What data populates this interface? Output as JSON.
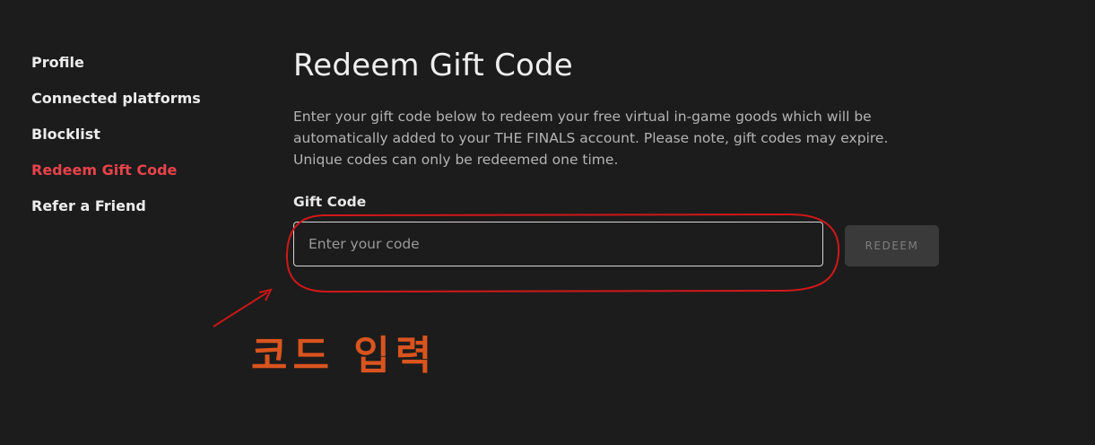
{
  "sidebar": {
    "items": [
      {
        "label": "Profile",
        "active": false
      },
      {
        "label": "Connected platforms",
        "active": false
      },
      {
        "label": "Blocklist",
        "active": false
      },
      {
        "label": "Redeem Gift Code",
        "active": true
      },
      {
        "label": "Refer a Friend",
        "active": false
      }
    ]
  },
  "main": {
    "title": "Redeem Gift Code",
    "description": "Enter your gift code below to redeem your free virtual in-game goods which will be automatically added to your THE FINALS account. Please note, gift codes may expire. Unique codes can only be redeemed one time.",
    "field_label": "Gift Code",
    "input": {
      "value": "",
      "placeholder": "Enter your code"
    },
    "redeem_label": "REDEEM"
  },
  "annotation": {
    "text": "코드 입력",
    "color": "#d9541e",
    "circle_color": "#d01818",
    "arrow_color": "#c81818"
  },
  "colors": {
    "background": "#1c1c1c",
    "accent": "#e8434b",
    "button_bg": "#3a3a3a",
    "button_text": "#7e7e7e"
  }
}
